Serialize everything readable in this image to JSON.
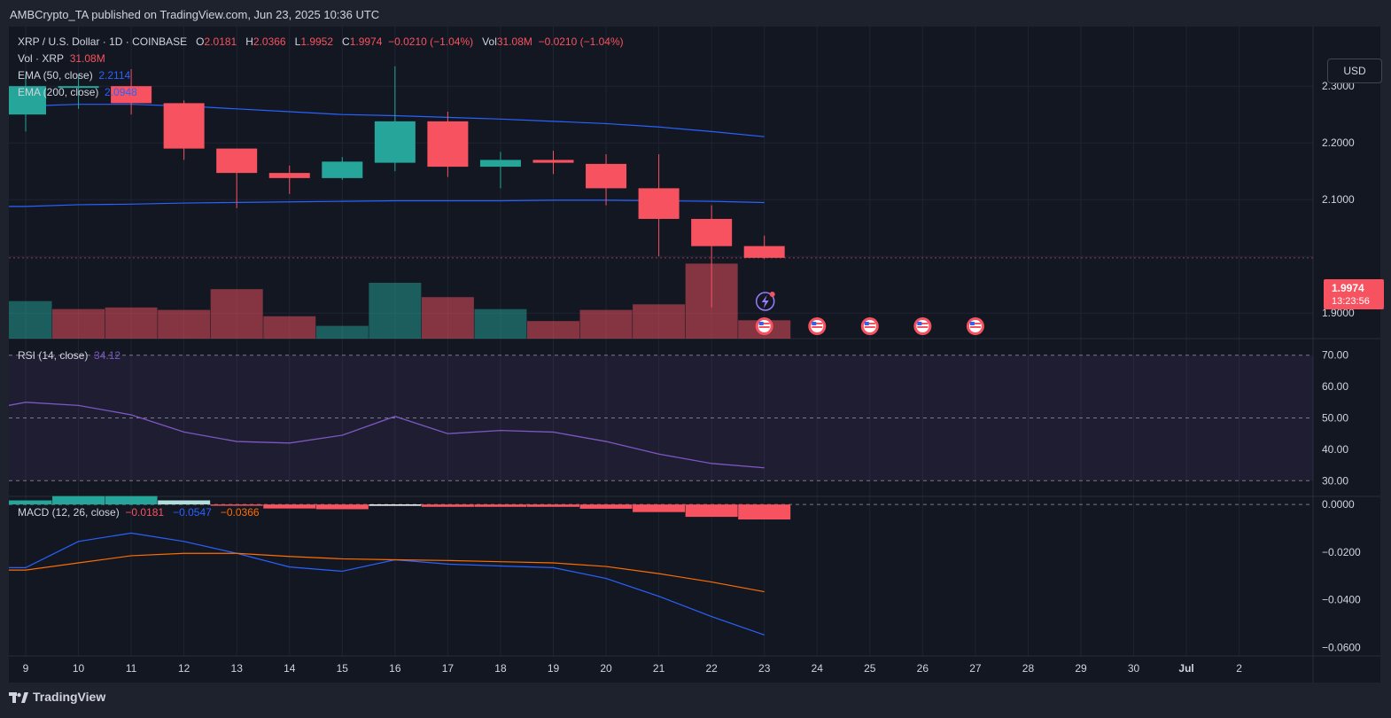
{
  "header": {
    "published": "AMBCrypto_TA published on TradingView.com, Jun 23, 2025 10:36 UTC"
  },
  "legend": {
    "symbol": "XRP / U.S. Dollar · 1D · COINBASE",
    "o_label": "O",
    "o_value": "2.0181",
    "h_label": "H",
    "h_value": "2.0366",
    "l_label": "L",
    "l_value": "1.9952",
    "c_label": "C",
    "c_value": "1.9974",
    "change": "−0.0210 (−1.04%)",
    "vol_label": "Vol",
    "vol_value": "31.08M",
    "vol_change": "−0.0210 (−1.04%)",
    "vol_line_label": "Vol · XRP",
    "vol_line_value": "31.08M",
    "ema50_label": "EMA (50, close)",
    "ema50_value": "2.2114",
    "ema200_label": "EMA (200, close)",
    "ema200_value": "2.0948",
    "rsi_label": "RSI (14, close)",
    "rsi_value": "34.12",
    "macd_label": "MACD (12, 26, close)",
    "macd_value": "−0.0181",
    "macd_signal_value": "−0.0547",
    "macd_hist_value": "−0.0366"
  },
  "currency_button": "USD",
  "last_price": {
    "price": "1.9974",
    "countdown": "13:23:56"
  },
  "footer": {
    "brand": "TradingView"
  },
  "colors": {
    "up": "#26a69a",
    "down": "#f7525f",
    "ema50": "#2962ff",
    "ema200": "#2962ff",
    "rsi": "#7e57c2",
    "macd": "#2962ff",
    "signal": "#ff6d00"
  },
  "chart_data": [
    {
      "type": "candlestick",
      "title": "XRP / U.S. Dollar · 1D · COINBASE",
      "x_ticks": [
        "9",
        "10",
        "11",
        "12",
        "13",
        "14",
        "15",
        "16",
        "17",
        "18",
        "19",
        "20",
        "21",
        "22",
        "23",
        "24",
        "25",
        "26",
        "27",
        "28",
        "29",
        "30",
        "Jul",
        "2"
      ],
      "y_ticks": [
        "2.3000",
        "2.2000",
        "2.1000",
        "1.9000"
      ],
      "ylim": [
        1.855,
        2.405
      ],
      "candles": [
        {
          "x": "9",
          "o": 2.25,
          "h": 2.32,
          "l": 2.22,
          "c": 2.3
        },
        {
          "x": "10",
          "o": 2.3,
          "h": 2.32,
          "l": 2.26,
          "c": 2.3
        },
        {
          "x": "11",
          "o": 2.3,
          "h": 2.33,
          "l": 2.25,
          "c": 2.27
        },
        {
          "x": "12",
          "o": 2.27,
          "h": 2.275,
          "l": 2.17,
          "c": 2.19
        },
        {
          "x": "13",
          "o": 2.19,
          "h": 2.19,
          "l": 2.085,
          "c": 2.147
        },
        {
          "x": "14",
          "o": 2.147,
          "h": 2.16,
          "l": 2.11,
          "c": 2.138
        },
        {
          "x": "15",
          "o": 2.138,
          "h": 2.175,
          "l": 2.135,
          "c": 2.167
        },
        {
          "x": "16",
          "o": 2.165,
          "h": 2.335,
          "l": 2.15,
          "c": 2.238
        },
        {
          "x": "17",
          "o": 2.238,
          "h": 2.255,
          "l": 2.14,
          "c": 2.158
        },
        {
          "x": "18",
          "o": 2.158,
          "h": 2.184,
          "l": 2.12,
          "c": 2.17
        },
        {
          "x": "19",
          "o": 2.17,
          "h": 2.186,
          "l": 2.145,
          "c": 2.165
        },
        {
          "x": "20",
          "o": 2.163,
          "h": 2.18,
          "l": 2.09,
          "c": 2.12
        },
        {
          "x": "21",
          "o": 2.12,
          "h": 2.18,
          "l": 2.0,
          "c": 2.066
        },
        {
          "x": "22",
          "o": 2.066,
          "h": 2.09,
          "l": 1.91,
          "c": 2.018
        },
        {
          "x": "23",
          "o": 2.0181,
          "h": 2.0366,
          "l": 1.9952,
          "c": 1.9974
        }
      ],
      "volume": [
        {
          "x": "9",
          "v": 0.47,
          "up": true
        },
        {
          "x": "10",
          "v": 0.37,
          "up": false
        },
        {
          "x": "11",
          "v": 0.39,
          "up": false
        },
        {
          "x": "12",
          "v": 0.36,
          "up": false
        },
        {
          "x": "13",
          "v": 0.62,
          "up": false
        },
        {
          "x": "14",
          "v": 0.28,
          "up": false
        },
        {
          "x": "15",
          "v": 0.16,
          "up": true
        },
        {
          "x": "16",
          "v": 0.7,
          "up": true
        },
        {
          "x": "17",
          "v": 0.52,
          "up": false
        },
        {
          "x": "18",
          "v": 0.37,
          "up": true
        },
        {
          "x": "19",
          "v": 0.22,
          "up": false
        },
        {
          "x": "20",
          "v": 0.36,
          "up": false
        },
        {
          "x": "21",
          "v": 0.43,
          "up": false
        },
        {
          "x": "22",
          "v": 0.94,
          "up": false
        },
        {
          "x": "23",
          "v": 0.23,
          "up": false
        }
      ],
      "ema50": [
        2.265,
        2.268,
        2.268,
        2.265,
        2.26,
        2.255,
        2.25,
        2.248,
        2.245,
        2.242,
        2.238,
        2.234,
        2.228,
        2.22,
        2.211
      ],
      "ema200": [
        2.088,
        2.091,
        2.092,
        2.094,
        2.095,
        2.096,
        2.097,
        2.098,
        2.098,
        2.098,
        2.099,
        2.099,
        2.098,
        2.097,
        2.0948
      ]
    },
    {
      "type": "line",
      "title": "RSI (14, close)",
      "y_ticks": [
        "70.00",
        "60.00",
        "50.00",
        "40.00",
        "30.00"
      ],
      "ylim": [
        25,
        75
      ],
      "band": [
        30,
        70
      ],
      "values": [
        55,
        54,
        51,
        45.5,
        42.5,
        42,
        44.5,
        50.5,
        45,
        46,
        45.5,
        42.5,
        38.5,
        35.5,
        34.12
      ]
    },
    {
      "type": "bar",
      "title": "MACD (12, 26, close)",
      "y_ticks": [
        "0.0000",
        "−0.0200",
        "−0.0400",
        "−0.0600"
      ],
      "ylim": [
        -0.0635,
        0.003
      ],
      "histogram": [
        0.0017,
        0.0035,
        0.0035,
        0.0017,
        -0.0003,
        -0.0017,
        -0.002,
        -0.0002,
        -0.001,
        -0.001,
        -0.001,
        -0.0018,
        -0.0032,
        -0.0052,
        -0.0063
      ],
      "macd": [
        -0.0265,
        -0.0155,
        -0.012,
        -0.0155,
        -0.0205,
        -0.0262,
        -0.028,
        -0.0232,
        -0.025,
        -0.0258,
        -0.0265,
        -0.031,
        -0.0385,
        -0.047,
        -0.0547
      ],
      "signal": [
        -0.0275,
        -0.0245,
        -0.0215,
        -0.0205,
        -0.0205,
        -0.0218,
        -0.0228,
        -0.0232,
        -0.0235,
        -0.024,
        -0.0245,
        -0.026,
        -0.029,
        -0.0325,
        -0.0366
      ]
    }
  ]
}
